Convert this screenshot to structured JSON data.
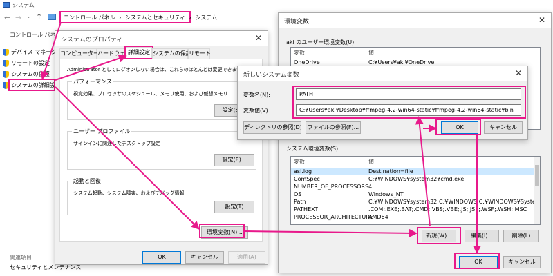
{
  "window": {
    "title": "システム"
  },
  "address": {
    "crumbs": [
      "コントロール パネル",
      "システムとセキュリティ",
      "システム"
    ],
    "separator": "›"
  },
  "left_nav": {
    "home": "コントロール パネル ホーム",
    "items": [
      "デバイス マネージャー",
      "リモートの設定",
      "システムの保護",
      "システムの詳細設定"
    ],
    "related_title": "関連項目",
    "related": [
      "セキュリティとメンテナンス"
    ]
  },
  "sysprops": {
    "title": "システムのプロパティ",
    "tabs": [
      "コンピューター名",
      "ハードウェア",
      "詳細設定",
      "システムの保護",
      "リモート"
    ],
    "admin_note": "Administrator としてログオンしない場合は、これらのほとんどは変更できません。",
    "perf": {
      "legend": "パフォーマンス",
      "desc": "視覚効果、プロセッサのスケジュール、メモリ使用、および仮想メモリ",
      "button": "設定(S)..."
    },
    "profile": {
      "legend": "ユーザー プロファイル",
      "desc": "サインインに関連したデスクトップ設定",
      "button": "設定(E)..."
    },
    "startup": {
      "legend": "起動と回復",
      "desc": "システム起動、システム障害、およびデバッグ情報",
      "button": "設定(T)"
    },
    "env_button": "環境変数(N)...",
    "ok": "OK",
    "cancel": "キャンセル",
    "apply": "適用(A)"
  },
  "envvars": {
    "title": "環境変数",
    "user_label": "aki のユーザー環境変数(U)",
    "user_headers": [
      "変数",
      "値"
    ],
    "user_rows": [
      {
        "name": "OneDrive",
        "value": "C:¥Users¥aki¥OneDrive"
      }
    ],
    "system_label": "システム環境変数(S)",
    "system_headers": [
      "変数",
      "値"
    ],
    "system_rows": [
      {
        "name": "asl.log",
        "value": "Destination=file"
      },
      {
        "name": "ComSpec",
        "value": "C:¥WINDOWS¥system32¥cmd.exe"
      },
      {
        "name": "NUMBER_OF_PROCESSORS",
        "value": "4"
      },
      {
        "name": "OS",
        "value": "Windows_NT"
      },
      {
        "name": "Path",
        "value": "C:¥WINDOWS¥system32;C:¥WINDOWS;C:¥WINDOWS¥System32¥W..."
      },
      {
        "name": "PATHEXT",
        "value": ".COM;.EXE;.BAT;.CMD;.VBS;.VBE;.JS;.JSE;.WSF;.WSH;.MSC"
      },
      {
        "name": "PROCESSOR_ARCHITECTURE",
        "value": "AMD64"
      }
    ],
    "new_button": "新規(W)...",
    "edit_button": "編集(I)...",
    "delete_button": "削除(L)",
    "ok": "OK",
    "cancel": "キャンセル"
  },
  "newvar": {
    "title": "新しいシステム変数",
    "name_label": "変数名(N):",
    "name_value": "PATH",
    "value_label": "変数値(V):",
    "value_value": "C:¥Users¥aki¥Desktop¥ffmpeg-4.2-win64-static¥ffmpeg-4.2-win64-static¥bin",
    "browse_dir": "ディレクトリの参照(D)...",
    "browse_file": "ファイルの参照(F)...",
    "ok": "OK",
    "cancel": "キャンセル"
  },
  "colors": {
    "annotation": "#e8198b",
    "selection": "#cce8ff",
    "default_button_border": "#0078d7"
  }
}
